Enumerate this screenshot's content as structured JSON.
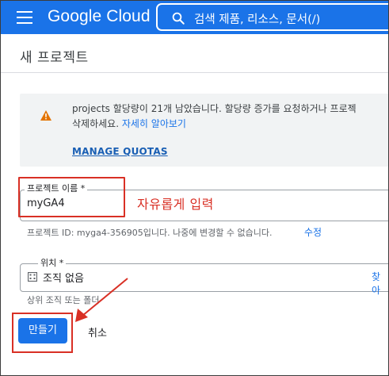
{
  "topbar": {
    "brand": "Google Cloud",
    "search_text": "검색  제품, 리소스, 문서(/)"
  },
  "page": {
    "title": "새 프로젝트"
  },
  "banner": {
    "text_line1": "projects 할당량이 21개 남았습니다. 할당량 증가를 요청하거나 프로젝",
    "text_line2": "삭제하세요. ",
    "learn_more": "자세히 알아보기",
    "manage_quotas": "MANAGE QUOTAS"
  },
  "project_name": {
    "label": "프로젝트 이름 *",
    "value": "myGA4",
    "annotation": "자유롭게 입력"
  },
  "project_id": {
    "text": "프로젝트 ID: myga4-356905입니다. 나중에 변경할 수 없습니다.",
    "edit_label": "수정"
  },
  "location": {
    "label": "위치 *",
    "value": "조직 없음",
    "browse_label": "찾아",
    "helper": "상위 조직 또는 폴더"
  },
  "actions": {
    "create_label": "만들기",
    "cancel_label": "취소"
  },
  "colors": {
    "primary": "#1a73e8",
    "annotation_red": "#d93025",
    "warning": "#e37400"
  }
}
